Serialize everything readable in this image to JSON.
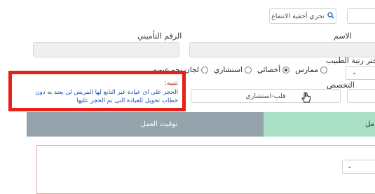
{
  "search": {
    "button_label": "تحري أحقية الانتفاع",
    "icon": "search-icon"
  },
  "form": {
    "name_label": "الاسم",
    "insurance_number_label": "الرقم التأميني",
    "doctor_rank_label": "اختر رتبة الطبيب",
    "rank_options": [
      {
        "label": "ممارس",
        "checked": false
      },
      {
        "label": "أخصائي",
        "checked": true
      },
      {
        "label": "استشاري",
        "checked": false
      },
      {
        "label": "لجان نحو عيوبه",
        "checked": false
      }
    ],
    "specialty_label": "التخصص",
    "specialty_button_label": "قلب-استشاري"
  },
  "notice": {
    "title": "تنبيه:",
    "body": "الحجز على اى عيادة غير التابع لها المريض لن يعتد به دون خطاب تحويل للعيادة التى تم الحجز عليها"
  },
  "tabs": {
    "work_schedule_label": "توقيت العمل",
    "left_tab_partial": "مل"
  },
  "colors": {
    "notice_border": "#e8201a",
    "tab_gray": "#95a3ad",
    "tab_green": "#a8dfc5",
    "notice_text": "#1a56b8"
  }
}
